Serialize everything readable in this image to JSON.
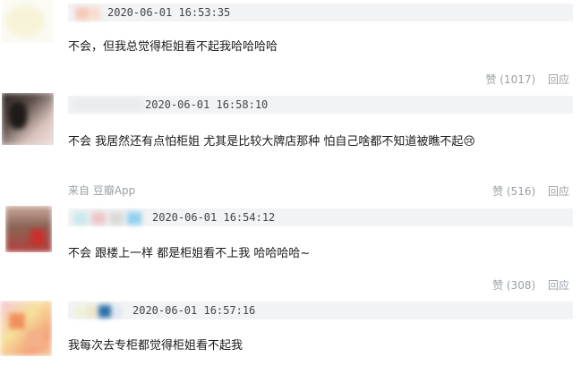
{
  "comments": [
    {
      "time": "2020-06-01 16:53:35",
      "text": "不会，但我总觉得柜姐看不起我哈哈哈哈",
      "like_label": "赞 (1017)",
      "reply_label": "回应"
    },
    {
      "time": "2020-06-01 16:58:10",
      "text": "不会 我居然还有点怕柜姐 尤其是比较大牌店那种 怕自己啥都不知道被瞧不起😢",
      "source": "来自 豆瓣App",
      "like_label": "赞 (516)",
      "reply_label": "回应"
    },
    {
      "time": "2020-06-01 16:54:12",
      "text": "不会 跟楼上一样 都是柜姐看不上我 哈哈哈哈~",
      "like_label": "赞 (308)",
      "reply_label": "回应"
    },
    {
      "time": "2020-06-01 16:57:16",
      "text": "我每次去专柜都觉得柜姐看不起我"
    }
  ],
  "colors": {
    "meta_bar": "#f2f3f5",
    "muted_text": "#9aa0a6",
    "body_text": "#1a1a1a"
  }
}
